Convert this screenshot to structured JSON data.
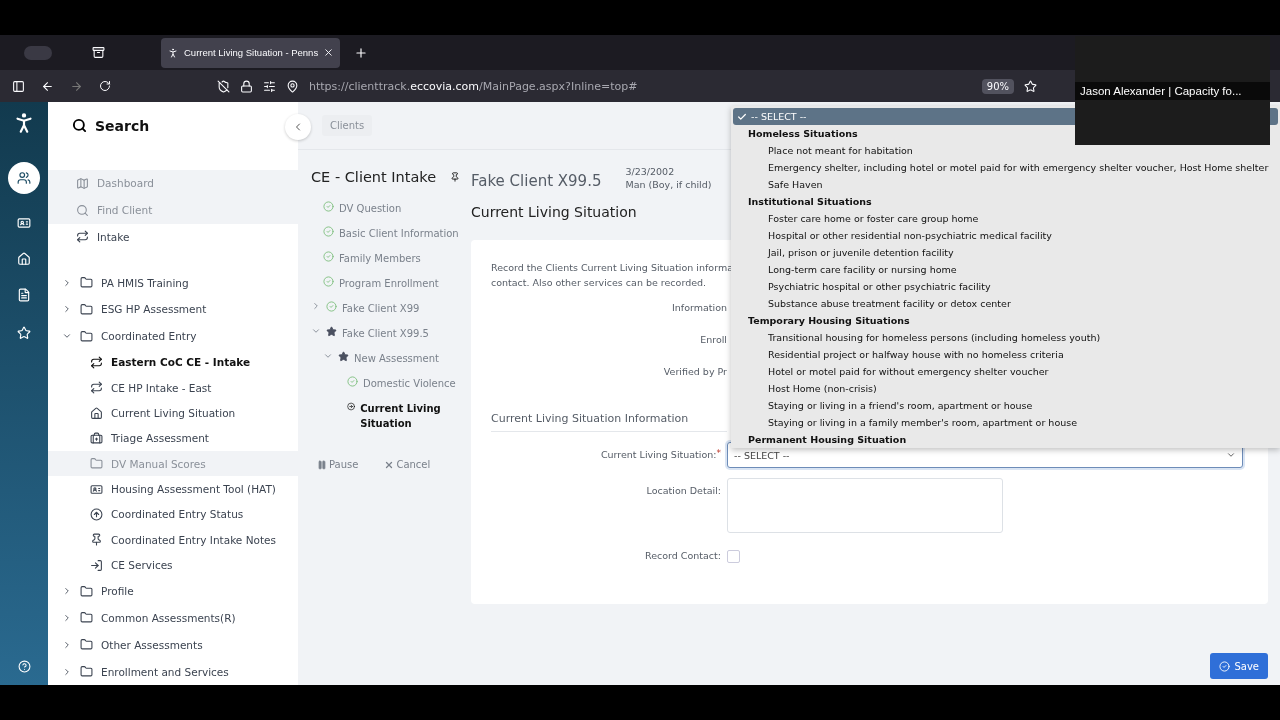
{
  "browser": {
    "tab_title": "Current Living Situation - Penns",
    "url_scheme": "https://clienttrack.",
    "url_domain": "eccovia.com",
    "url_path": "/MainPage.aspx?Inline=top#",
    "zoom": "90%"
  },
  "video_caption": "Jason Alexander | Capacity fo...",
  "nav": {
    "search_label": "Search",
    "top_items": [
      {
        "label": "Dashboard",
        "kind": "map",
        "disabled": true
      },
      {
        "label": "Find Client",
        "kind": "search",
        "disabled": true
      },
      {
        "label": "Intake",
        "kind": "cycle",
        "disabled": false
      }
    ],
    "tree": [
      {
        "label": "PA HMIS Training",
        "expanded": false
      },
      {
        "label": "ESG HP Assessment",
        "expanded": false
      },
      {
        "label": "Coordinated Entry",
        "expanded": true,
        "children": [
          {
            "label": "Eastern CoC CE - Intake",
            "kind": "cycle",
            "selected": true,
            "disabled": false
          },
          {
            "label": "CE HP Intake - East",
            "kind": "cycle",
            "selected": false,
            "disabled": false
          },
          {
            "label": "Current Living Situation",
            "kind": "home",
            "selected": false,
            "disabled": false
          },
          {
            "label": "Triage Assessment",
            "kind": "medkit",
            "selected": false,
            "disabled": false
          },
          {
            "label": "DV Manual Scores",
            "kind": "folder",
            "selected": false,
            "disabled": true
          },
          {
            "label": "Housing Assessment Tool (HAT)",
            "kind": "card",
            "selected": false,
            "disabled": false
          },
          {
            "label": "Coordinated Entry Status",
            "kind": "upload",
            "selected": false,
            "disabled": false
          },
          {
            "label": "Coordinated Entry Intake Notes",
            "kind": "pin",
            "selected": false,
            "disabled": false
          },
          {
            "label": "CE Services",
            "kind": "signin",
            "selected": false,
            "disabled": false
          }
        ]
      },
      {
        "label": "Profile",
        "expanded": false
      },
      {
        "label": "Common Assessments(R)",
        "expanded": false
      },
      {
        "label": "Other Assessments",
        "expanded": false
      },
      {
        "label": "Enrollment and Services",
        "expanded": false
      }
    ]
  },
  "breadcrumb": "Clients",
  "workflow": {
    "title": "CE - Client Intake",
    "steps": [
      {
        "label": "DV Question",
        "kind": "done",
        "selected": false
      },
      {
        "label": "Basic Client Information",
        "kind": "done",
        "selected": false
      },
      {
        "label": "Family Members",
        "kind": "done",
        "selected": false
      },
      {
        "label": "Program Enrollment",
        "kind": "done",
        "selected": false
      },
      {
        "label": "Fake Client X99",
        "kind": "done",
        "selected": false,
        "expanded": false
      },
      {
        "label": "Fake Client X99.5",
        "kind": "star",
        "selected": false,
        "expanded": true,
        "children": [
          {
            "label": "New Assessment",
            "kind": "star",
            "selected": false,
            "expanded": true,
            "children": [
              {
                "label": "Domestic Violence",
                "kind": "done",
                "selected": false
              },
              {
                "label": "Current Living Situation",
                "kind": "current",
                "selected": true
              }
            ]
          }
        ]
      }
    ],
    "pause": "Pause",
    "cancel": "Cancel"
  },
  "client": {
    "name": "Fake Client X99.5",
    "dob": "3/23/2002",
    "gender": "Man (Boy, if child)"
  },
  "form": {
    "heading": "Current Living Situation",
    "intro_line_1": "Record the Clients Current Living Situation informa",
    "intro_line_2": "contact.  Also other services can be recorded.",
    "hidden_labels": [
      "Information",
      "Enroll",
      "Verified by Pr"
    ],
    "section_title": "Current Living Situation Information",
    "fields": [
      {
        "kind": "select",
        "label": "Current Living Situation:",
        "required_mark": "*",
        "value": "-- SELECT --"
      },
      {
        "kind": "textarea",
        "label": "Location Detail:"
      },
      {
        "kind": "checkbox",
        "label": "Record Contact:",
        "checked": false
      }
    ]
  },
  "save": "Save",
  "dropdown": [
    {
      "kind": "option",
      "label": "-- SELECT --",
      "selected": true
    },
    {
      "kind": "group",
      "label": "Homeless Situations"
    },
    {
      "kind": "option",
      "label": "Place not meant for habitation",
      "selected": false
    },
    {
      "kind": "option",
      "label": "Emergency shelter, including hotel or motel paid for with emergency shelter voucher, Host Home shelter",
      "selected": false
    },
    {
      "kind": "option",
      "label": "Safe Haven",
      "selected": false
    },
    {
      "kind": "group",
      "label": "Institutional Situations"
    },
    {
      "kind": "option",
      "label": "Foster care home or foster care group home",
      "selected": false
    },
    {
      "kind": "option",
      "label": "Hospital or other residential non-psychiatric medical facility",
      "selected": false
    },
    {
      "kind": "option",
      "label": "Jail, prison or juvenile detention facility",
      "selected": false
    },
    {
      "kind": "option",
      "label": "Long-term care facility or nursing home",
      "selected": false
    },
    {
      "kind": "option",
      "label": "Psychiatric hospital or other psychiatric facility",
      "selected": false
    },
    {
      "kind": "option",
      "label": "Substance abuse treatment facility or detox center",
      "selected": false
    },
    {
      "kind": "group",
      "label": "Temporary Housing Situations"
    },
    {
      "kind": "option",
      "label": "Transitional housing for homeless persons (including homeless youth)",
      "selected": false
    },
    {
      "kind": "option",
      "label": "Residential project or halfway house with no homeless criteria",
      "selected": false
    },
    {
      "kind": "option",
      "label": "Hotel or motel paid for without emergency shelter voucher",
      "selected": false
    },
    {
      "kind": "option",
      "label": "Host Home (non-crisis)",
      "selected": false
    },
    {
      "kind": "option",
      "label": "Staying or living in a friend's room, apartment or house",
      "selected": false
    },
    {
      "kind": "option",
      "label": "Staying or living in a family member's room, apartment or house",
      "selected": false
    },
    {
      "kind": "group",
      "label": "Permanent Housing Situation"
    }
  ]
}
